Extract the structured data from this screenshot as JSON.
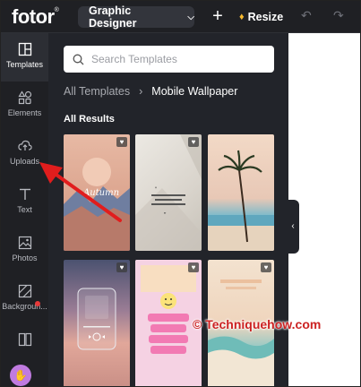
{
  "app": {
    "logo": "fotor",
    "logo_mark": "®"
  },
  "topbar": {
    "design_type": "Graphic Designer",
    "resize_label": "Resize"
  },
  "sidebar": {
    "items": [
      {
        "label": "Templates",
        "icon": "templates-icon",
        "active": true
      },
      {
        "label": "Elements",
        "icon": "elements-icon"
      },
      {
        "label": "Uploads",
        "icon": "uploads-icon"
      },
      {
        "label": "Text",
        "icon": "text-icon"
      },
      {
        "label": "Photos",
        "icon": "photos-icon"
      },
      {
        "label": "Backgroun...",
        "icon": "background-icon"
      }
    ]
  },
  "panel": {
    "search_placeholder": "Search Templates",
    "breadcrumb_parent": "All Templates",
    "breadcrumb_current": "Mobile Wallpaper",
    "results_heading": "All Results",
    "template_card_1_text": "Autumn"
  },
  "annotation": {
    "watermark": "© Techniquehow.com"
  },
  "colors": {
    "accent_red": "#e11d1d",
    "sidebar_bg": "#1f2024",
    "panel_bg": "#22242a"
  }
}
